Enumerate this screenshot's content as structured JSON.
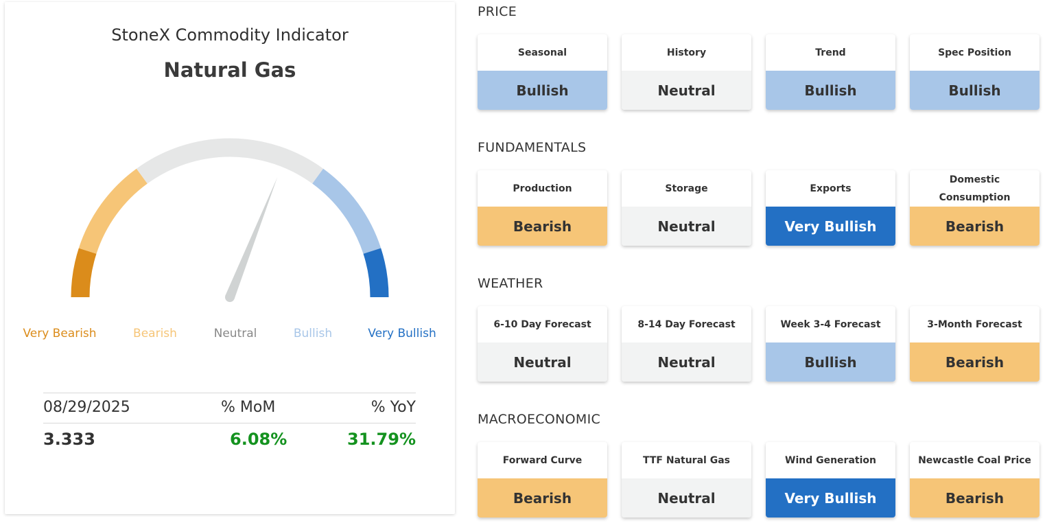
{
  "indicator": {
    "title": "StoneX Commodity Indicator",
    "commodity": "Natural Gas",
    "gauge_reading": 0.62,
    "scale": [
      {
        "label": "Very Bearish",
        "color": "#db8c1b"
      },
      {
        "label": "Bearish",
        "color": "#f6c577"
      },
      {
        "label": "Neutral",
        "color": "#888888"
      },
      {
        "label": "Bullish",
        "color": "#a8c6e8"
      },
      {
        "label": "Very Bullish",
        "color": "#2370c4"
      }
    ],
    "stats": {
      "date": "08/29/2025",
      "mom_label": "% MoM",
      "yoy_label": "% YoY",
      "price": "3.333",
      "mom": "6.08%",
      "yoy": "31.79%",
      "positive_color": "#14921f"
    }
  },
  "sections": [
    {
      "title": "PRICE",
      "cards": [
        {
          "label": "Seasonal",
          "signal": "Bullish"
        },
        {
          "label": "History",
          "signal": "Neutral"
        },
        {
          "label": "Trend",
          "signal": "Bullish"
        },
        {
          "label": "Spec Position",
          "signal": "Bullish"
        }
      ]
    },
    {
      "title": "FUNDAMENTALS",
      "cards": [
        {
          "label": "Production",
          "signal": "Bearish"
        },
        {
          "label": "Storage",
          "signal": "Neutral"
        },
        {
          "label": "Exports",
          "signal": "Very Bullish"
        },
        {
          "label": "Domestic Consumption",
          "signal": "Bearish"
        }
      ]
    },
    {
      "title": "WEATHER",
      "cards": [
        {
          "label": "6-10 Day Forecast",
          "signal": "Neutral"
        },
        {
          "label": "8-14 Day Forecast",
          "signal": "Neutral"
        },
        {
          "label": "Week 3-4 Forecast",
          "signal": "Bullish"
        },
        {
          "label": "3-Month Forecast",
          "signal": "Bearish"
        }
      ]
    },
    {
      "title": "MACROECONOMIC",
      "cards": [
        {
          "label": "Forward Curve",
          "signal": "Bearish"
        },
        {
          "label": "TTF Natural Gas",
          "signal": "Neutral"
        },
        {
          "label": "Wind Generation",
          "signal": "Very Bullish"
        },
        {
          "label": "Newcastle Coal Price",
          "signal": "Bearish"
        }
      ]
    }
  ]
}
